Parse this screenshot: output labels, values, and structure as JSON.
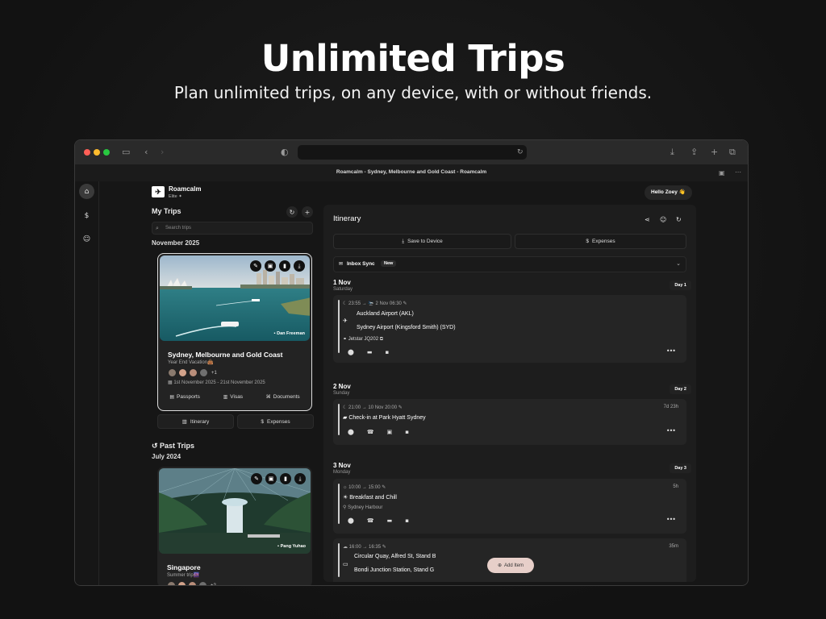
{
  "hero": {
    "title": "Unlimited Trips",
    "subtitle": "Plan unlimited trips, on any device, with or without friends."
  },
  "browser": {
    "tab_title": "Roamcalm - Sydney, Melbourne and Gold Coast - Roamcalm",
    "traffic_light_colors": [
      "#ff5f57",
      "#febc2e",
      "#28c840"
    ],
    "toolbar_icons": [
      "sidebar-icon",
      "back-icon",
      "forward-icon",
      "shield-icon",
      "reload-icon",
      "download-icon",
      "share-icon",
      "new-tab-icon",
      "tabs-icon"
    ]
  },
  "app": {
    "brand": "Roamcalm",
    "tier": "Elite ✦",
    "greeting": "Hello Zoey 👋",
    "rail_icons": [
      "home-icon",
      "dollar-icon",
      "profile-icon"
    ]
  },
  "sidebar": {
    "title": "My Trips",
    "search_placeholder": "Search trips",
    "current_month": "November 2025",
    "current_trip": {
      "photo_credit": "Dan Freeman",
      "name": "Sydney, Melbourne and Gold Coast",
      "description": "Year End Vacation👜",
      "extra_travellers": "+1",
      "dates": "1st November 2025 - 21st November 2025",
      "links": [
        "Passports",
        "Visas",
        "Documents"
      ]
    },
    "itinerary_button": "Itinerary",
    "expenses_button": "Expenses",
    "past_title": "Past Trips",
    "past_month": "July 2024",
    "past_trip": {
      "photo_credit": "Pang Yuhao",
      "name": "Singapore",
      "description": "Summer trip🌆",
      "extra_travellers": "+2"
    }
  },
  "itinerary": {
    "title": "Itinerary",
    "save_button": "Save to Device",
    "expenses_button": "Expenses",
    "inbox_label": "Inbox Sync",
    "inbox_badge": "New",
    "days": [
      {
        "date": "1 Nov",
        "weekday": "Saturday",
        "badge": "Day 1",
        "item": {
          "time": "23:55 → 🛬 2 Nov 06:30",
          "from": "Auckland Airport (AKL)",
          "to": "Sydney Airport (Kingsford Smith) (SYD)",
          "flight": "Jetstar JQ202"
        }
      },
      {
        "date": "2 Nov",
        "weekday": "Sunday",
        "badge": "Day 2",
        "item": {
          "time": "21:00 → 10 Nov 20:00",
          "title": "Check-in at Park Hyatt Sydney",
          "duration": "7d 23h"
        }
      },
      {
        "date": "3 Nov",
        "weekday": "Monday",
        "badge": "Day 3",
        "items": [
          {
            "time": "10:00 → 15:00",
            "title": "Breakfast and Chill",
            "location": "Sydney Harbour",
            "duration": "5h"
          },
          {
            "time": "16:00 → 16:35",
            "from": "Circular Quay, Alfred St, Stand B",
            "to": "Bondi Junction Station, Stand G",
            "duration": "35m"
          }
        ]
      }
    ],
    "add_item": "Add Item"
  }
}
